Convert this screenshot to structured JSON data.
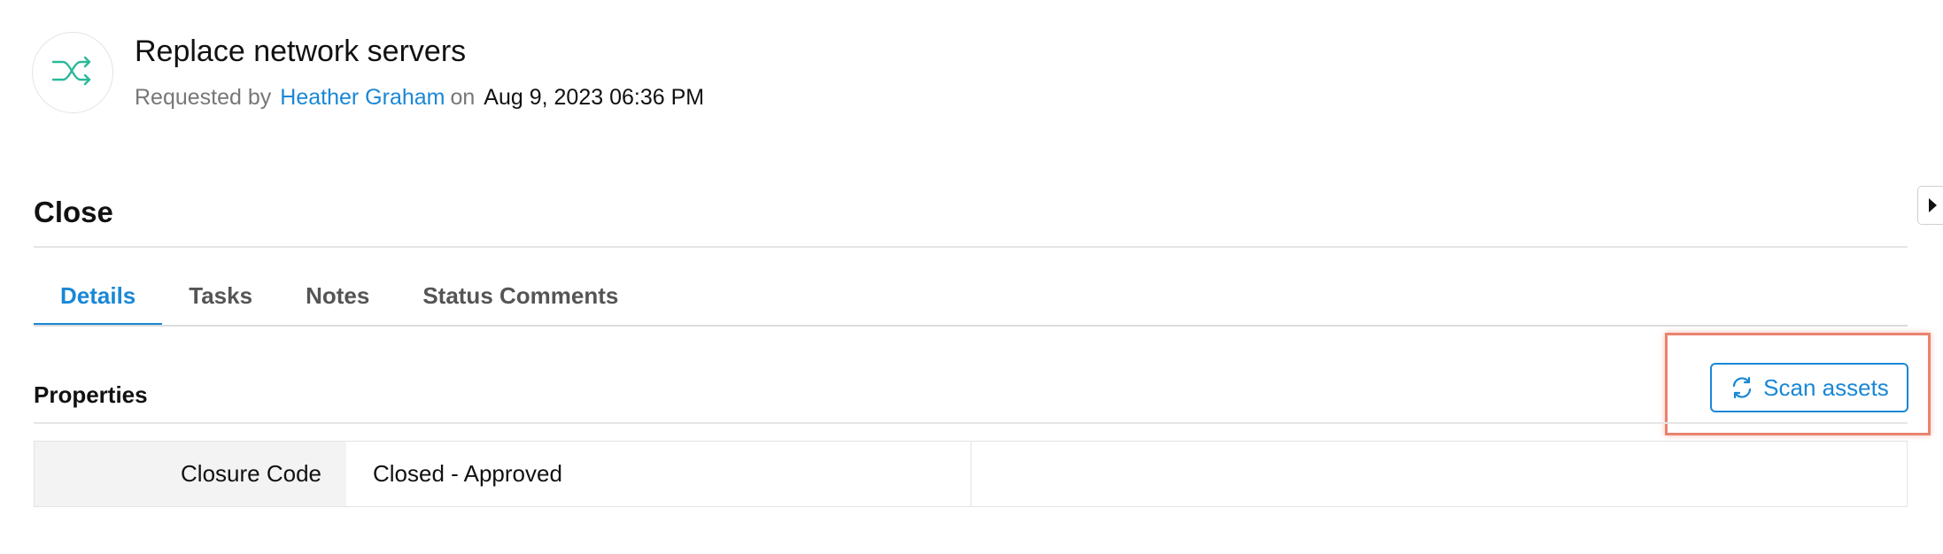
{
  "header": {
    "icon": "shuffle-icon",
    "title": "Replace network servers",
    "requested_by_label": "Requested by",
    "requester": "Heather Graham",
    "on_label": "on",
    "datetime": "Aug 9, 2023 06:36 PM"
  },
  "section": {
    "title": "Close",
    "toggle_icon": "caret-right-icon"
  },
  "tabs": [
    {
      "label": "Details",
      "active": true
    },
    {
      "label": "Tasks",
      "active": false
    },
    {
      "label": "Notes",
      "active": false
    },
    {
      "label": "Status Comments",
      "active": false
    }
  ],
  "properties": {
    "title": "Properties",
    "scan_button": {
      "label": "Scan assets",
      "icon": "refresh-icon"
    },
    "rows": [
      {
        "label": "Closure Code",
        "value": "Closed - Approved"
      }
    ]
  },
  "colors": {
    "accent": "#1a87d6",
    "icon_green": "#2bb99a",
    "highlight": "#e9836f"
  }
}
